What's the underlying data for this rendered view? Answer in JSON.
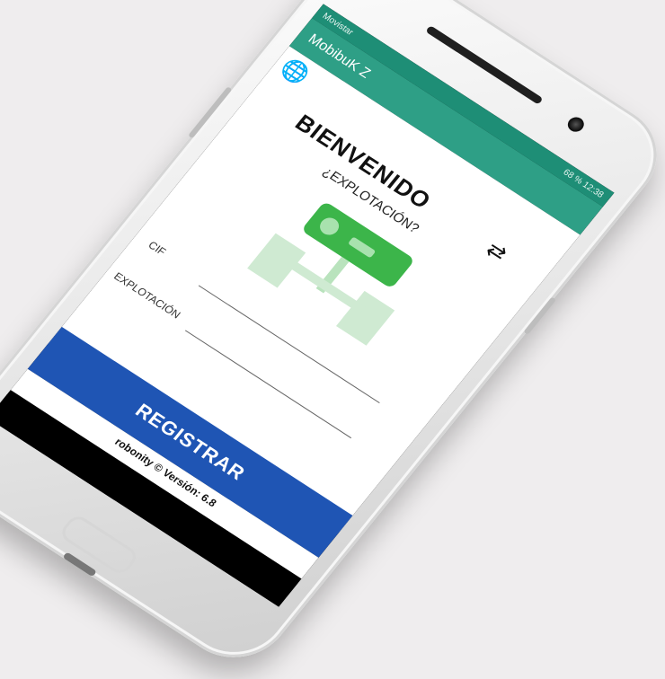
{
  "status_bar": {
    "carrier": "Movistar",
    "battery": "68 %",
    "time": "12:38"
  },
  "app_bar": {
    "title": "MobibuK Z"
  },
  "main": {
    "heading": "BIENVENIDO",
    "question": "¿EXPLOTACIÓN?",
    "fields": {
      "cif_label": "CIF",
      "explotacion_label": "EXPLOTACIÓN"
    },
    "register_button": "REGISTRAR",
    "footer": "robonity © Versión: 6.8"
  },
  "icons": {
    "globe": "globe-icon",
    "swap": "swap-arrows-icon",
    "back": "nav-back-icon",
    "home": "nav-home-icon",
    "recents": "nav-recents-icon"
  },
  "colors": {
    "status_bar": "#1e8e76",
    "app_bar": "#2e9f86",
    "register_button": "#1f55b4",
    "logo_green": "#3cb54a"
  }
}
